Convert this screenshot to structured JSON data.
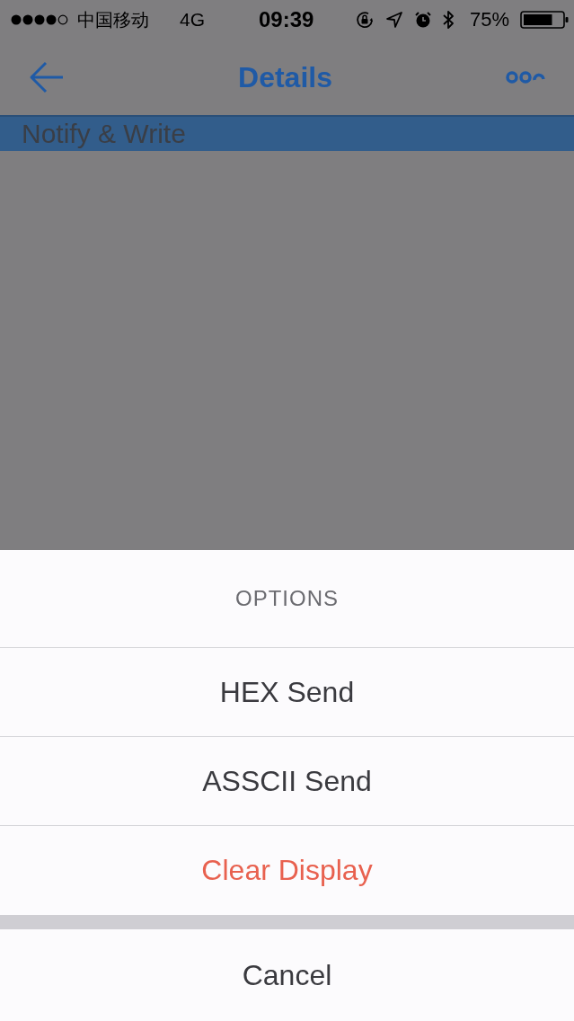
{
  "status_bar": {
    "carrier": "中国移动",
    "network": "4G",
    "time": "09:39",
    "battery_percent": "75%"
  },
  "nav_bar": {
    "title": "Details"
  },
  "section_header": {
    "label": "Notify & Write"
  },
  "action_sheet": {
    "title": "OPTIONS",
    "actions": [
      {
        "label": "HEX Send",
        "kind": "default"
      },
      {
        "label": "ASSCII Send",
        "kind": "default"
      },
      {
        "label": "Clear Display",
        "kind": "destructive"
      }
    ],
    "cancel": {
      "label": "Cancel"
    }
  }
}
